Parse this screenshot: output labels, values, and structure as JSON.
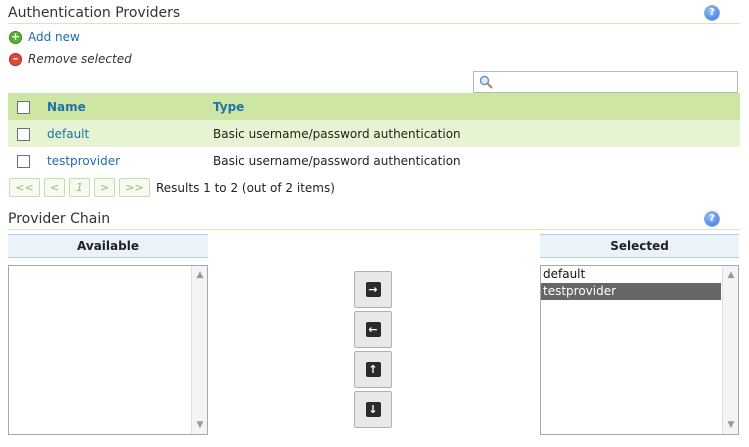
{
  "auth_section": {
    "title": "Authentication Providers",
    "help_icon": "question-icon",
    "add_label": "Add new",
    "remove_label": "Remove selected",
    "search": {
      "value": "",
      "placeholder": ""
    }
  },
  "providers_table": {
    "columns": [
      "Name",
      "Type"
    ],
    "rows": [
      {
        "name": "default",
        "type": "Basic username/password authentication"
      },
      {
        "name": "testprovider",
        "type": "Basic username/password authentication"
      }
    ]
  },
  "pager": {
    "first": "<<",
    "prev": "<",
    "page": "1",
    "next": ">",
    "last": ">>",
    "info": "Results 1 to 2 (out of 2 items)"
  },
  "chain_section": {
    "title": "Provider Chain",
    "available_header": "Available",
    "selected_header": "Selected",
    "available_items": [],
    "selected_items": [
      "default",
      "testprovider"
    ],
    "selected_highlight": "testprovider",
    "buttons": [
      "arrow-right-icon",
      "arrow-left-icon",
      "arrow-up-icon",
      "arrow-down-icon"
    ]
  },
  "colors": {
    "table_header": "#cde6a4",
    "highlight_row": "#e7f4d3",
    "link": "#1d6fa5",
    "selected_option": "#666666"
  }
}
